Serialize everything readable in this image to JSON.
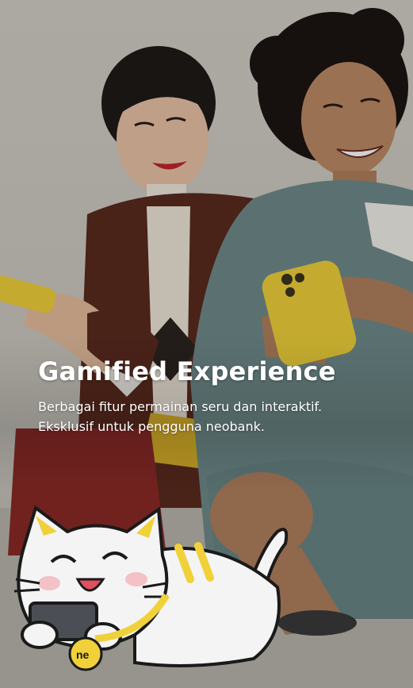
{
  "onboarding": {
    "title": "Gamified Experience",
    "description_line1": "Berbagai fitur permainan seru dan interaktif.",
    "description_line2": "Eksklusif untuk pengguna neobank.",
    "mascot_badge": "ne"
  },
  "illustration": {
    "subject": "two-people-holding-phones",
    "mascot": "cat-mascot-icon",
    "accent_color": "#f0d13a",
    "background_color": "#d2cfc6"
  }
}
